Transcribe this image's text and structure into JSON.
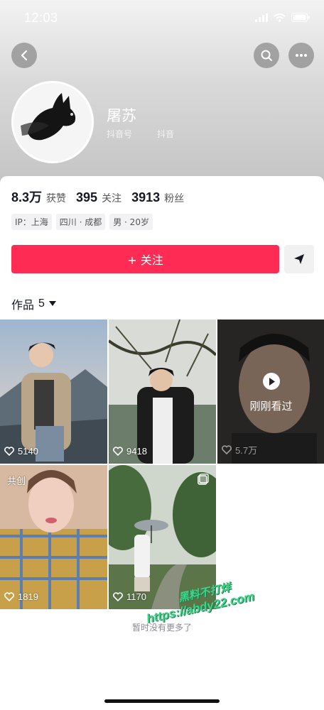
{
  "status_bar": {
    "time": "12:03"
  },
  "profile": {
    "nickname": "屠苏",
    "douyin_id_label": "抖音号",
    "douyin_id_value": "抖音"
  },
  "stats": [
    {
      "value": "8.3万",
      "label": "获赞"
    },
    {
      "value": "395",
      "label": "关注"
    },
    {
      "value": "3913",
      "label": "粉丝"
    }
  ],
  "tags": [
    "IP：上海",
    "四川 · 成都",
    "男 · 20岁"
  ],
  "actions": {
    "follow_label": "+ 关注"
  },
  "works_tab": {
    "label": "作品",
    "count": "5"
  },
  "videos": [
    {
      "likes": "5140"
    },
    {
      "likes": "9418"
    },
    {
      "likes": "5.7万",
      "overlay_label": "刚刚看过"
    },
    {
      "likes": "1819",
      "badge": "共创"
    },
    {
      "likes": "1170"
    }
  ],
  "footer": {
    "text": "暂时没有更多了"
  },
  "watermark": {
    "line1": "黑料不打烊",
    "line2": "https://abdy22.com"
  },
  "colors": {
    "follow": "#fe2c55",
    "text": "#161823",
    "watermark": "#3fd38a"
  },
  "icons": [
    "back-arrow-icon",
    "search-icon",
    "more-icon",
    "share-icon",
    "heart-icon",
    "play-icon",
    "chevron-down-icon"
  ]
}
